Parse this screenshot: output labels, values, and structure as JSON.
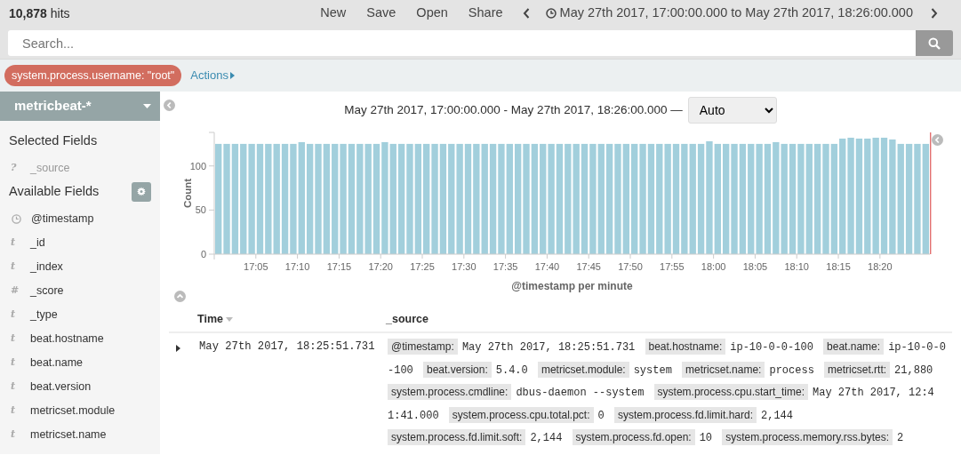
{
  "top_bar": {
    "hits_count": "10,878",
    "hits_label": "hits",
    "menu": [
      "New",
      "Save",
      "Open",
      "Share"
    ],
    "time_range": "May 27th 2017, 17:00:00.000 to May 27th 2017, 18:26:00.000"
  },
  "search": {
    "placeholder": "Search..."
  },
  "filters": [
    {
      "label": "system.process.username: \"root\""
    }
  ],
  "actions": "Actions",
  "sidebar": {
    "index_pattern": "metricbeat-*",
    "selected_title": "Selected Fields",
    "selected_fields": [
      {
        "kind": "unknown",
        "glyph": "?",
        "name": "_source"
      }
    ],
    "available_title": "Available Fields",
    "available_fields": [
      {
        "kind": "date",
        "name": "@timestamp"
      },
      {
        "kind": "string",
        "glyph": "t",
        "name": "_id"
      },
      {
        "kind": "string",
        "glyph": "t",
        "name": "_index"
      },
      {
        "kind": "number",
        "glyph": "#",
        "name": "_score"
      },
      {
        "kind": "string",
        "glyph": "t",
        "name": "_type"
      },
      {
        "kind": "string",
        "glyph": "t",
        "name": "beat.hostname"
      },
      {
        "kind": "string",
        "glyph": "t",
        "name": "beat.name"
      },
      {
        "kind": "string",
        "glyph": "t",
        "name": "beat.version"
      },
      {
        "kind": "string",
        "glyph": "t",
        "name": "metricset.module"
      },
      {
        "kind": "string",
        "glyph": "t",
        "name": "metricset.name"
      }
    ]
  },
  "histogram": {
    "range_label": "May 27th 2017, 17:00:00.000 - May 27th 2017, 18:26:00.000 —",
    "interval": "Auto",
    "chart_data": {
      "type": "bar",
      "xlabel": "@timestamp per minute",
      "ylabel": "Count",
      "ylim": [
        0,
        138
      ],
      "yticks": [
        0,
        50,
        100
      ],
      "categories": [
        null,
        null,
        null,
        null,
        null,
        "17:05",
        null,
        null,
        null,
        null,
        "17:10",
        null,
        null,
        null,
        null,
        "17:15",
        null,
        null,
        null,
        null,
        "17:20",
        null,
        null,
        null,
        null,
        "17:25",
        null,
        null,
        null,
        null,
        "17:30",
        null,
        null,
        null,
        null,
        "17:35",
        null,
        null,
        null,
        null,
        "17:40",
        null,
        null,
        null,
        null,
        "17:45",
        null,
        null,
        null,
        null,
        "17:50",
        null,
        null,
        null,
        null,
        "17:55",
        null,
        null,
        null,
        null,
        "18:00",
        null,
        null,
        null,
        null,
        "18:05",
        null,
        null,
        null,
        null,
        "18:10",
        null,
        null,
        null,
        null,
        "18:15",
        null,
        null,
        null,
        null,
        "18:20",
        null,
        null,
        null,
        null,
        null
      ],
      "values": [
        125,
        125,
        125,
        125,
        125,
        125,
        125,
        125,
        125,
        125,
        127,
        125,
        125,
        125,
        125,
        125,
        125,
        125,
        125,
        125,
        127,
        125,
        125,
        125,
        125,
        125,
        125,
        125,
        125,
        125,
        125,
        125,
        125,
        125,
        125,
        125,
        125,
        125,
        125,
        125,
        125,
        125,
        125,
        125,
        125,
        125,
        125,
        125,
        125,
        125,
        125,
        125,
        125,
        125,
        125,
        125,
        125,
        125,
        125,
        128,
        125,
        125,
        125,
        125,
        125,
        125,
        125,
        127,
        125,
        125,
        125,
        125,
        125,
        125,
        125,
        131,
        132,
        131,
        131,
        132,
        132,
        130,
        125,
        125,
        125,
        125
      ]
    }
  },
  "table": {
    "columns": [
      {
        "label": "Time",
        "sorted": true
      },
      {
        "label": "_source",
        "sorted": false
      }
    ],
    "rows": [
      {
        "expanded": false,
        "time": "May 27th 2017, 18:25:51.731",
        "source": [
          {
            "key": "@timestamp:",
            "value": "May 27th 2017, 18:25:51.731"
          },
          {
            "key": "beat.hostname:",
            "value": "ip-10-0-0-100"
          },
          {
            "key": "beat.name:",
            "value": "ip-10-0-0-100"
          },
          {
            "key": "beat.version:",
            "value": "5.4.0"
          },
          {
            "key": "metricset.module:",
            "value": "system"
          },
          {
            "key": "metricset.name:",
            "value": "process"
          },
          {
            "key": "metricset.rtt:",
            "value": "21,880"
          },
          {
            "key": "system.process.cmdline:",
            "value": "dbus-daemon --system"
          },
          {
            "key": "system.process.cpu.start_time:",
            "value": "May 27th 2017, 12:41:41.000"
          },
          {
            "key": "system.process.cpu.total.pct:",
            "value": "0"
          },
          {
            "key": "system.process.fd.limit.hard:",
            "value": "2,144"
          },
          {
            "key": "system.process.fd.limit.soft:",
            "value": "2,144"
          },
          {
            "key": "system.process.fd.open:",
            "value": "10"
          },
          {
            "key": "system.process.memory.rss.bytes:",
            "value": "2"
          }
        ]
      }
    ]
  }
}
